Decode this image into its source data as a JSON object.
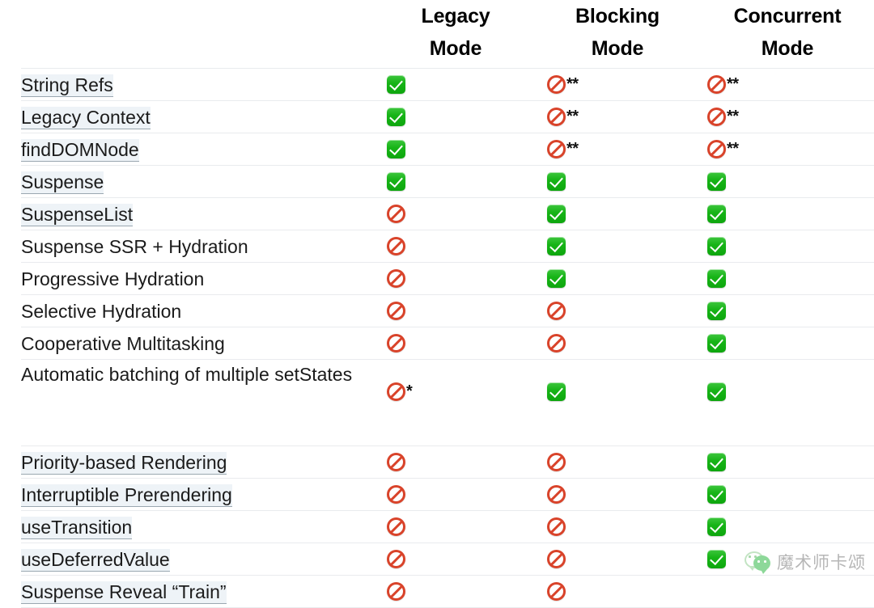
{
  "table": {
    "feature_column_header": "",
    "columns": [
      {
        "id": "legacy",
        "line1": "Legacy",
        "line2": "Mode"
      },
      {
        "id": "blocking",
        "line1": "Blocking",
        "line2": "Mode"
      },
      {
        "id": "concurrent",
        "line1": "Concurrent",
        "line2": "Mode"
      }
    ],
    "rows": [
      {
        "feature": "String Refs",
        "is_link": true,
        "cells": [
          {
            "icon": "check-icon",
            "note": ""
          },
          {
            "icon": "no-entry-icon",
            "note": "**"
          },
          {
            "icon": "no-entry-icon",
            "note": "**"
          }
        ]
      },
      {
        "feature": "Legacy Context",
        "is_link": true,
        "cells": [
          {
            "icon": "check-icon",
            "note": ""
          },
          {
            "icon": "no-entry-icon",
            "note": "**"
          },
          {
            "icon": "no-entry-icon",
            "note": "**"
          }
        ]
      },
      {
        "feature": "findDOMNode",
        "is_link": true,
        "cells": [
          {
            "icon": "check-icon",
            "note": ""
          },
          {
            "icon": "no-entry-icon",
            "note": "**"
          },
          {
            "icon": "no-entry-icon",
            "note": "**"
          }
        ]
      },
      {
        "feature": "Suspense",
        "is_link": true,
        "cells": [
          {
            "icon": "check-icon",
            "note": ""
          },
          {
            "icon": "check-icon",
            "note": ""
          },
          {
            "icon": "check-icon",
            "note": ""
          }
        ]
      },
      {
        "feature": "SuspenseList",
        "is_link": true,
        "cells": [
          {
            "icon": "no-entry-icon",
            "note": ""
          },
          {
            "icon": "check-icon",
            "note": ""
          },
          {
            "icon": "check-icon",
            "note": ""
          }
        ]
      },
      {
        "feature": "Suspense SSR + Hydration",
        "is_link": false,
        "cells": [
          {
            "icon": "no-entry-icon",
            "note": ""
          },
          {
            "icon": "check-icon",
            "note": ""
          },
          {
            "icon": "check-icon",
            "note": ""
          }
        ]
      },
      {
        "feature": "Progressive Hydration",
        "is_link": false,
        "cells": [
          {
            "icon": "no-entry-icon",
            "note": ""
          },
          {
            "icon": "check-icon",
            "note": ""
          },
          {
            "icon": "check-icon",
            "note": ""
          }
        ]
      },
      {
        "feature": "Selective Hydration",
        "is_link": false,
        "cells": [
          {
            "icon": "no-entry-icon",
            "note": ""
          },
          {
            "icon": "no-entry-icon",
            "note": ""
          },
          {
            "icon": "check-icon",
            "note": ""
          }
        ]
      },
      {
        "feature": "Cooperative Multitasking",
        "is_link": false,
        "cells": [
          {
            "icon": "no-entry-icon",
            "note": ""
          },
          {
            "icon": "no-entry-icon",
            "note": ""
          },
          {
            "icon": "check-icon",
            "note": ""
          }
        ]
      },
      {
        "feature": "Automatic batching of multiple setStates",
        "is_link": false,
        "tall": true,
        "cells": [
          {
            "icon": "no-entry-icon",
            "note": "*"
          },
          {
            "icon": "check-icon",
            "note": ""
          },
          {
            "icon": "check-icon",
            "note": ""
          }
        ]
      },
      {
        "feature": "Priority-based Rendering",
        "is_link": true,
        "cells": [
          {
            "icon": "no-entry-icon",
            "note": ""
          },
          {
            "icon": "no-entry-icon",
            "note": ""
          },
          {
            "icon": "check-icon",
            "note": ""
          }
        ]
      },
      {
        "feature": "Interruptible Prerendering",
        "is_link": true,
        "cells": [
          {
            "icon": "no-entry-icon",
            "note": ""
          },
          {
            "icon": "no-entry-icon",
            "note": ""
          },
          {
            "icon": "check-icon",
            "note": ""
          }
        ]
      },
      {
        "feature": "useTransition",
        "is_link": true,
        "cells": [
          {
            "icon": "no-entry-icon",
            "note": ""
          },
          {
            "icon": "no-entry-icon",
            "note": ""
          },
          {
            "icon": "check-icon",
            "note": ""
          }
        ]
      },
      {
        "feature": "useDeferredValue",
        "is_link": true,
        "cells": [
          {
            "icon": "no-entry-icon",
            "note": ""
          },
          {
            "icon": "no-entry-icon",
            "note": ""
          },
          {
            "icon": "check-icon",
            "note": ""
          }
        ]
      },
      {
        "feature": "Suspense Reveal “Train”",
        "is_link": true,
        "cells": [
          {
            "icon": "no-entry-icon",
            "note": ""
          },
          {
            "icon": "no-entry-icon",
            "note": ""
          },
          {
            "icon": "",
            "note": ""
          }
        ]
      }
    ]
  },
  "watermark": {
    "logo": "wechat-logo",
    "text": "魔术师卡颂"
  },
  "colors": {
    "check_green": "#17b417",
    "ban_red": "#d9432a",
    "row_separator": "#e9ebee",
    "link_highlight": "#eef3f7",
    "text": "#1b1b1b",
    "watermark_text": "#8b8b8b",
    "wechat_green": "#49c15c"
  }
}
